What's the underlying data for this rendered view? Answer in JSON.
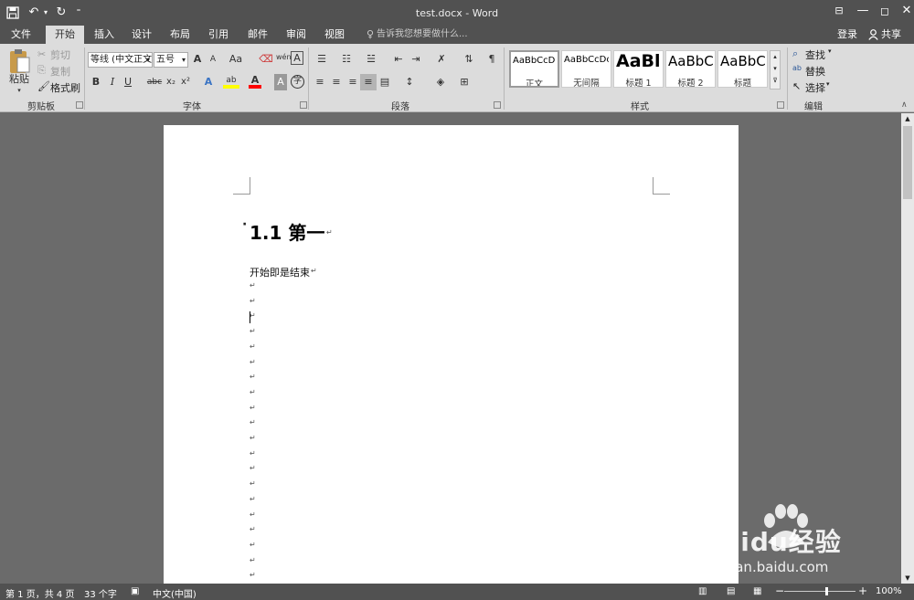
{
  "title_bar": {
    "title": "test.docx - Word",
    "quick_access": {
      "save_icon": "save-icon",
      "undo_icon": "undo-icon",
      "redo_icon": "redo-icon",
      "customize_icon": "customize-icon"
    },
    "window_controls": [
      "ribbon-display-icon",
      "minimize-icon",
      "restore-icon",
      "close-icon"
    ]
  },
  "tabs": [
    "文件",
    "开始",
    "插入",
    "设计",
    "布局",
    "引用",
    "邮件",
    "审阅",
    "视图"
  ],
  "active_tab": "开始",
  "tell_me": "告诉我您想要做什么...",
  "sign_in": "登录",
  "share": "共享",
  "clipboard": {
    "paste": "粘贴",
    "cut": "剪切",
    "copy": "复制",
    "format_painter": "格式刷",
    "label": "剪贴板"
  },
  "font": {
    "name": "等线 (中文正文",
    "size": "五号",
    "label": "字体",
    "grow": "A",
    "shrink": "A",
    "case": "Aa",
    "clear": "清除",
    "phonetic": "wén",
    "border_char": "A",
    "bold": "B",
    "italic": "I",
    "underline": "U",
    "strike": "abc",
    "sub": "x₂",
    "sup": "x²",
    "effects": "A",
    "highlight": "ab",
    "color": "A",
    "shading": "A",
    "enclose": "字"
  },
  "paragraph": {
    "label": "段落"
  },
  "styles": {
    "label": "样式",
    "items": [
      {
        "sample": "AaBbCcDc",
        "name": "正文"
      },
      {
        "sample": "AaBbCcDc",
        "name": "无间隔"
      },
      {
        "sample": "AaBl",
        "name": "标题 1"
      },
      {
        "sample": "AaBbC",
        "name": "标题 2"
      },
      {
        "sample": "AaBbC",
        "name": "标题"
      }
    ]
  },
  "editing": {
    "label": "编辑",
    "find": "查找",
    "replace": "替换",
    "select": "选择"
  },
  "document": {
    "heading": "1.1 第一",
    "body_text": "开始即是结束",
    "pilcrow": "↵",
    "empty_paragraph_count": 20
  },
  "status": {
    "page": "第 1 页，共 4 页",
    "words": "33 个字",
    "language": "中文(中国)",
    "zoom": "100%",
    "zoom_level": 100
  },
  "watermark": {
    "brand": "Baidu经验",
    "url": "jingyan.baidu.com"
  },
  "colors": {
    "highlight": "#ffff00",
    "font_color": "#ff0000",
    "dark_chrome": "#515151"
  }
}
